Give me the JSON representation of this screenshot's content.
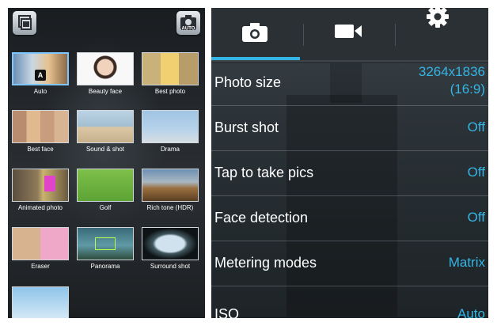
{
  "camera_modes": {
    "items": [
      {
        "label": "Auto",
        "badge": "A"
      },
      {
        "label": "Beauty face"
      },
      {
        "label": "Best photo"
      },
      {
        "label": "Best face"
      },
      {
        "label": "Sound & shot"
      },
      {
        "label": "Drama"
      },
      {
        "label": "Animated photo"
      },
      {
        "label": "Golf"
      },
      {
        "label": "Rich tone (HDR)"
      },
      {
        "label": "Eraser"
      },
      {
        "label": "Panorama"
      },
      {
        "label": "Surround shot"
      },
      {
        "label": ""
      }
    ]
  },
  "settings": {
    "tabs": [
      {
        "icon": "camera-icon"
      },
      {
        "icon": "video-camera-icon"
      },
      {
        "icon": "gear-icon"
      }
    ],
    "rows": [
      {
        "label": "Photo size",
        "value_line1": "3264x1836",
        "value_line2": "(16:9)"
      },
      {
        "label": "Burst shot",
        "value": "Off"
      },
      {
        "label": "Tap to take pics",
        "value": "Off"
      },
      {
        "label": "Face detection",
        "value": "Off"
      },
      {
        "label": "Metering modes",
        "value": "Matrix"
      },
      {
        "label": "ISO",
        "value": "Auto"
      }
    ]
  },
  "colors": {
    "accent": "#33b5e5",
    "active_border": "#7fc6ff"
  }
}
